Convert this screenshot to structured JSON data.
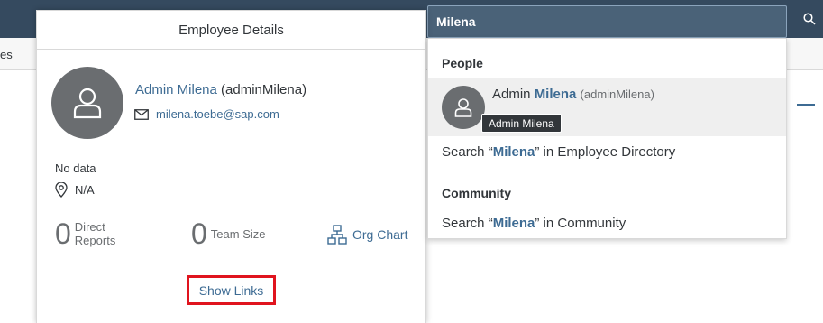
{
  "background": {
    "subnav_partial_text": "es"
  },
  "search": {
    "value": "Milena"
  },
  "employee_card": {
    "title": "Employee Details",
    "name": "Admin Milena",
    "username": "(adminMilena)",
    "email": "milena.toebe@sap.com",
    "no_data": "No data",
    "location": "N/A",
    "direct_reports": {
      "count": "0",
      "label_line1": "Direct",
      "label_line2": "Reports"
    },
    "team_size": {
      "count": "0",
      "label": "Team Size"
    },
    "org_chart_label": "Org Chart",
    "show_links_label": "Show Links"
  },
  "dropdown": {
    "people_title": "People",
    "person": {
      "first": "Admin ",
      "highlight": "Milena",
      "login": "(adminMilena)",
      "tooltip": "Admin Milena"
    },
    "search_directory": {
      "prefix": "Search “",
      "term": "Milena",
      "suffix": "” in Employee Directory"
    },
    "community_title": "Community",
    "search_community": {
      "prefix": "Search “",
      "term": "Milena",
      "suffix": "” in Community"
    }
  },
  "colors": {
    "shell": "#354a5f",
    "link": "#3d6b93",
    "highlight_box": "#e0141e",
    "avatar": "#6a6d70"
  },
  "icons": [
    "person-icon",
    "mail-icon",
    "location-pin-icon",
    "org-chart-icon",
    "search-icon"
  ]
}
